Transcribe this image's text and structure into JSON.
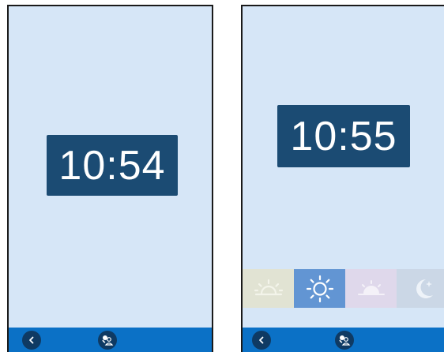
{
  "screens": [
    {
      "clock": {
        "time": "10:54"
      },
      "navbar": {
        "back_icon": "chevron-left-icon",
        "person_icon": "person-caregiver-icon"
      }
    },
    {
      "clock": {
        "time": "10:55"
      },
      "time_of_day": {
        "items": [
          {
            "icon": "sunrise-icon",
            "selected": false
          },
          {
            "icon": "sun-icon",
            "selected": true
          },
          {
            "icon": "sunset-icon",
            "selected": false
          },
          {
            "icon": "moon-icon",
            "selected": false
          }
        ]
      },
      "navbar": {
        "back_icon": "chevron-left-icon",
        "person_icon": "person-caregiver-icon"
      }
    }
  ],
  "colors": {
    "background": "#d6e6f7",
    "clock_bg": "#1b4b73",
    "navbar": "#0b71c6",
    "nav_button": "#0f3a63",
    "selected_cell": "#6295d3"
  }
}
